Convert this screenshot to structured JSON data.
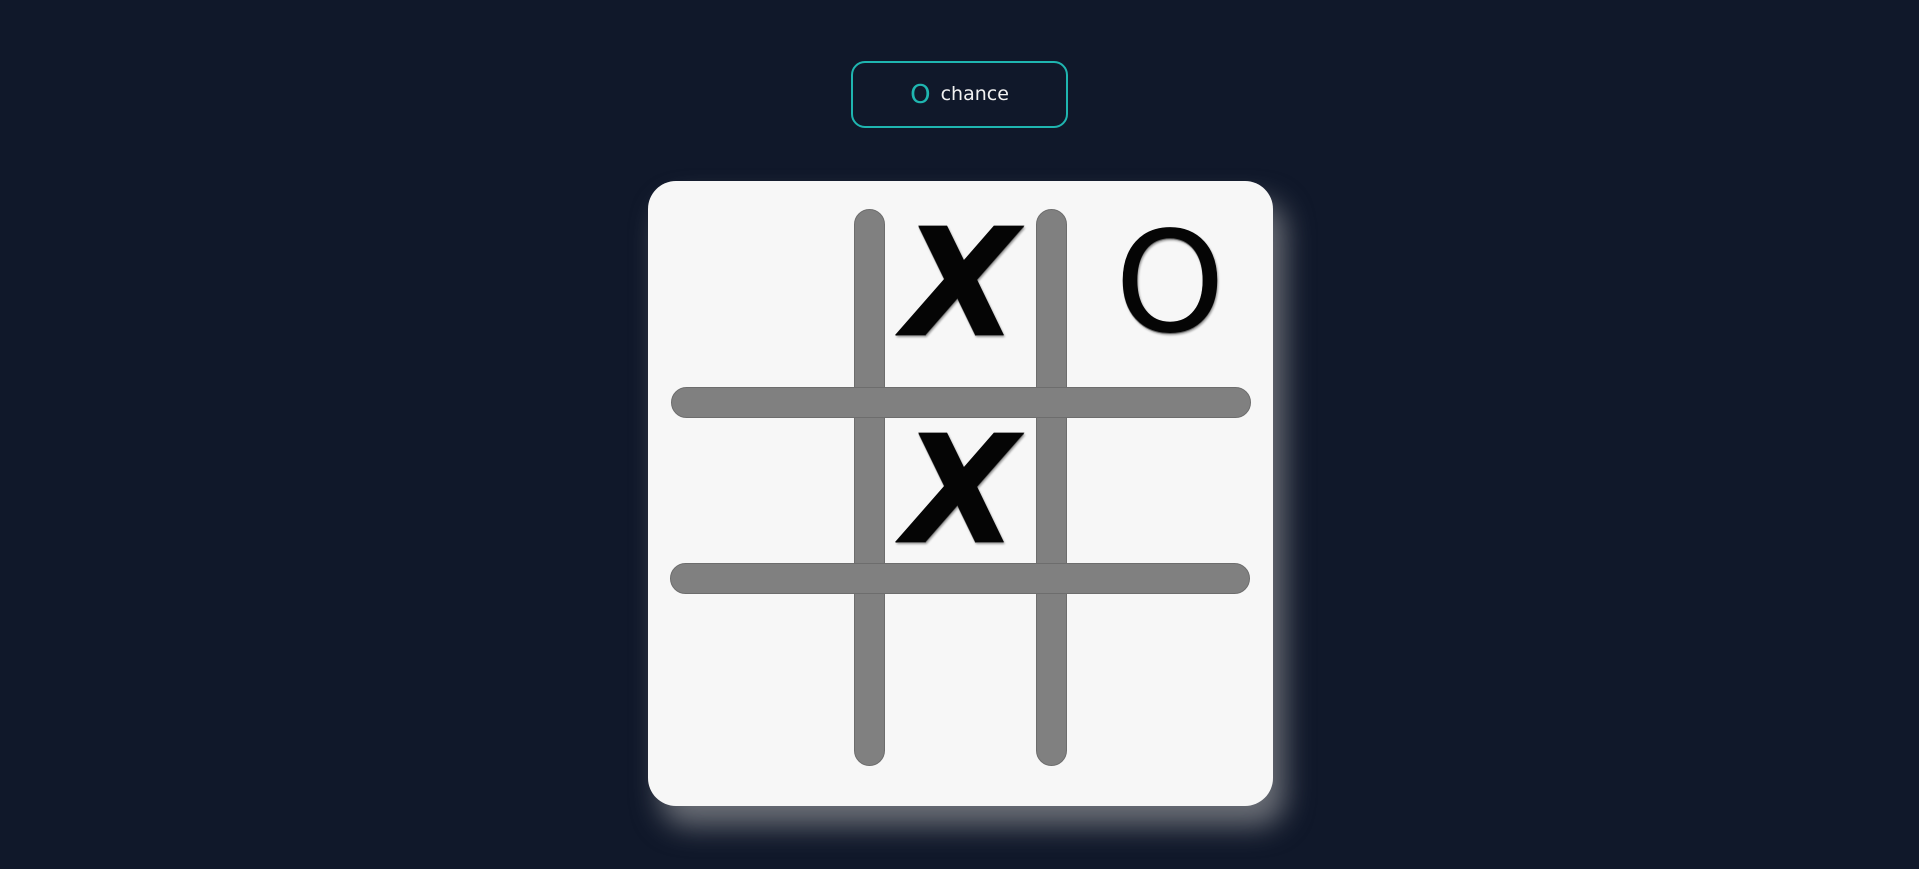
{
  "turn": {
    "symbol": "O",
    "label": "chance"
  },
  "colors": {
    "background": "#10182a",
    "accent": "#1fb5b0",
    "board": "#f7f7f7",
    "grid": "#808080",
    "mark": "#050505"
  },
  "board": {
    "cells": [
      "",
      "X",
      "O",
      "",
      "X",
      "",
      "",
      "",
      ""
    ]
  }
}
